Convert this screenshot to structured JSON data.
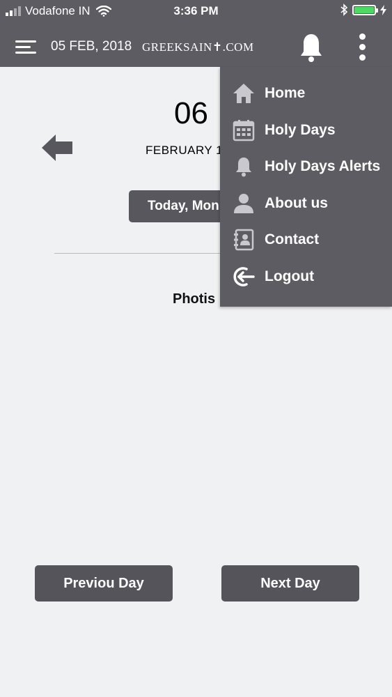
{
  "status_bar": {
    "carrier": "Vodafone IN",
    "time": "3:36 PM"
  },
  "app_bar": {
    "date": "05 FEB, 2018",
    "brand": "GREEKSAIN✝.COM"
  },
  "content": {
    "day_number": "06",
    "month_line": "FEBRUARY  1",
    "today_button": "Today, Mon",
    "saint_name": "Photis"
  },
  "navigation": {
    "prev_label": "Previou Day",
    "next_label": "Next Day"
  },
  "menu": {
    "items": [
      {
        "label": "Home",
        "icon": "home-icon"
      },
      {
        "label": "Holy Days",
        "icon": "calendar-icon"
      },
      {
        "label": "Holy Days Alerts",
        "icon": "bell-icon"
      },
      {
        "label": "About us",
        "icon": "user-icon"
      },
      {
        "label": "Contact",
        "icon": "address-book-icon"
      },
      {
        "label": "Logout",
        "icon": "logout-icon"
      }
    ]
  },
  "colors": {
    "bar": "#5d5c63",
    "button": "#55545b",
    "background": "#f0f1f2",
    "icon": "#c9c9cd",
    "battery": "#4cd964"
  }
}
